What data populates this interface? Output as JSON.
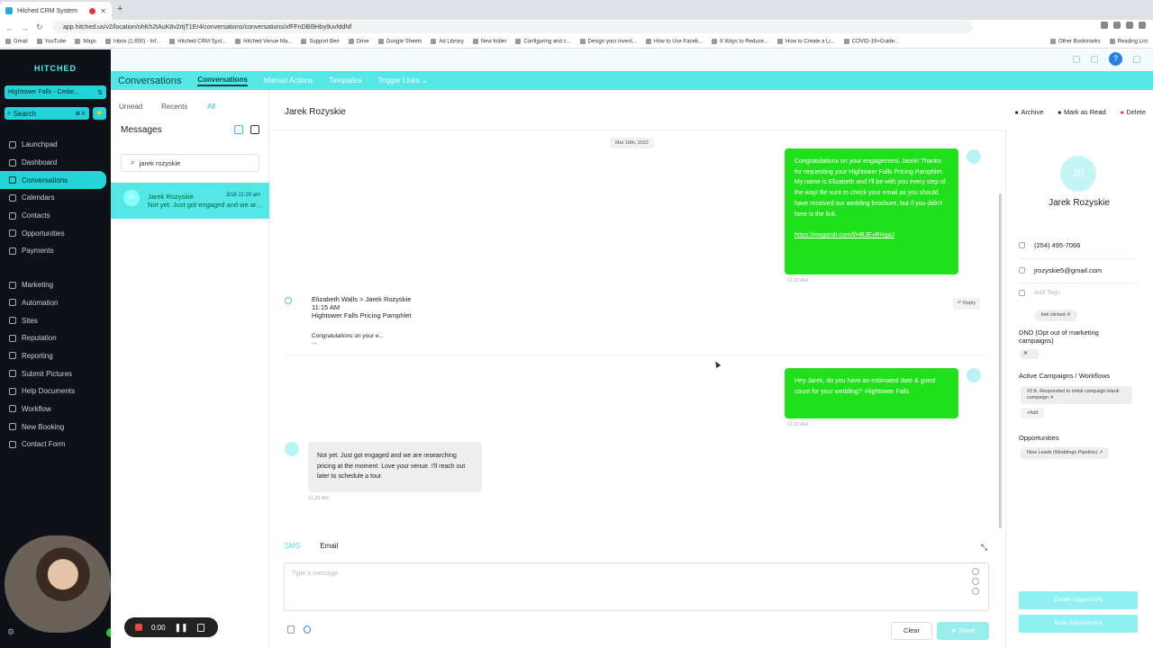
{
  "browser": {
    "tab_title": "Hitched CRM System",
    "url": "app.hitched.us/v2/location/ohKh2tAuK8v2rtjT1Er4/conversations/conversations/xfFFnDBl9Hby9uvfddNf",
    "bookmarks": [
      "Gmail",
      "YouTube",
      "Maps",
      "Inbox (1,650) - Inf...",
      "Hitched CRM Syst...",
      "Hitched Venue Ma...",
      "Support Bee",
      "Drive",
      "Google Sheets",
      "Ad Library",
      "New folder",
      "Configuring and c...",
      "Design your invest...",
      "How to Use Faceb...",
      "8 Ways to Reduce...",
      "How to Create a Li...",
      "COVID-19+Guide..."
    ],
    "bookmarks_right": [
      "Other Bookmarks",
      "Reading List"
    ]
  },
  "sidebar": {
    "logo": "HITCHED",
    "location": "Hightower Falls - Cedar...",
    "search_label": "Search",
    "search_kbd": "⌘ K",
    "items": [
      {
        "label": "Launchpad"
      },
      {
        "label": "Dashboard"
      },
      {
        "label": "Conversations"
      },
      {
        "label": "Calendars"
      },
      {
        "label": "Contacts"
      },
      {
        "label": "Opportunities"
      },
      {
        "label": "Payments"
      },
      {
        "label": "Marketing"
      },
      {
        "label": "Automation"
      },
      {
        "label": "Sites"
      },
      {
        "label": "Reputation"
      },
      {
        "label": "Reporting"
      },
      {
        "label": "Submit Pictures"
      },
      {
        "label": "Help Documents"
      },
      {
        "label": "Workflow"
      },
      {
        "label": "New Booking"
      },
      {
        "label": "Contact Form"
      }
    ]
  },
  "recorder": {
    "time": "0:00"
  },
  "header": {
    "title": "Conversations",
    "tabs": [
      "Conversations",
      "Manual Actions",
      "Templates",
      "Trigger Links"
    ]
  },
  "messages": {
    "filters": [
      "Unread",
      "Recents",
      "All"
    ],
    "title": "Messages",
    "search_value": "jarek rozyskie",
    "conversation": {
      "initials": "JR",
      "name": "Jarek Rozyskie",
      "date": "3/18 11:29 am",
      "preview": "Not yet. Just got engaged and we are researching"
    }
  },
  "chat": {
    "contact": "Jarek Rozyskie",
    "actions": [
      "Archive",
      "Mark as Read",
      "Delete"
    ],
    "date_chip": "Mar 18th, 2022",
    "msg1": "Congratulations on your engagement, Jarek! Thanks for requesting your Hightower Falls Pricing Pamphlet. My name is Elizabeth and I'll be with you every step of the way! Be sure to check your email as you should have received our wedding brochure, but if you didn't here is the link.",
    "msg1_link": "https://msgsndr.com/l/HBJEvRHgaJ",
    "msg1_time": "11:15 AM",
    "email_from": "Elizabeth Walls > Jarek Rozyskie",
    "email_time": "11:15 AM",
    "email_subject": "Hightower Falls Pricing Pamphlet",
    "email_body": "Congratulations on your e...",
    "reply_label": "Reply",
    "msg2": "Hey Jarek, do you have an estimated date & guest count for your wedding? -Hightower Falls",
    "msg2_time": "11:15 AM",
    "msg3": "Not yet. Just got engaged and we are researching pricing at the moment. Love your venue. I'll reach out later to schedule a tour.",
    "msg3_time": "11:29 AM"
  },
  "composer": {
    "tabs": [
      "SMS",
      "Email"
    ],
    "placeholder": "Type a message",
    "clear_label": "Clear",
    "send_label": "Send"
  },
  "contact": {
    "initials": "JR",
    "name": "Jarek Rozyskie",
    "phone": "(254) 495-7066",
    "email": "jrozyskie5@gmail.com",
    "tag_placeholder": "Add Tags",
    "tag": "link clicked",
    "dnd_label": "DND (Opt out of marketing campaigns)",
    "campaigns_label": "Active Campaigns / Workflows",
    "campaign": "#2 A. Responded to initial campaign blank campaign",
    "add_label": "Add",
    "opps_label": "Opportunities",
    "opportunity": "New Leads (Weddings Pipeline)",
    "create_opp": "Create Opportunity",
    "book_appt": "Book Appointment"
  }
}
